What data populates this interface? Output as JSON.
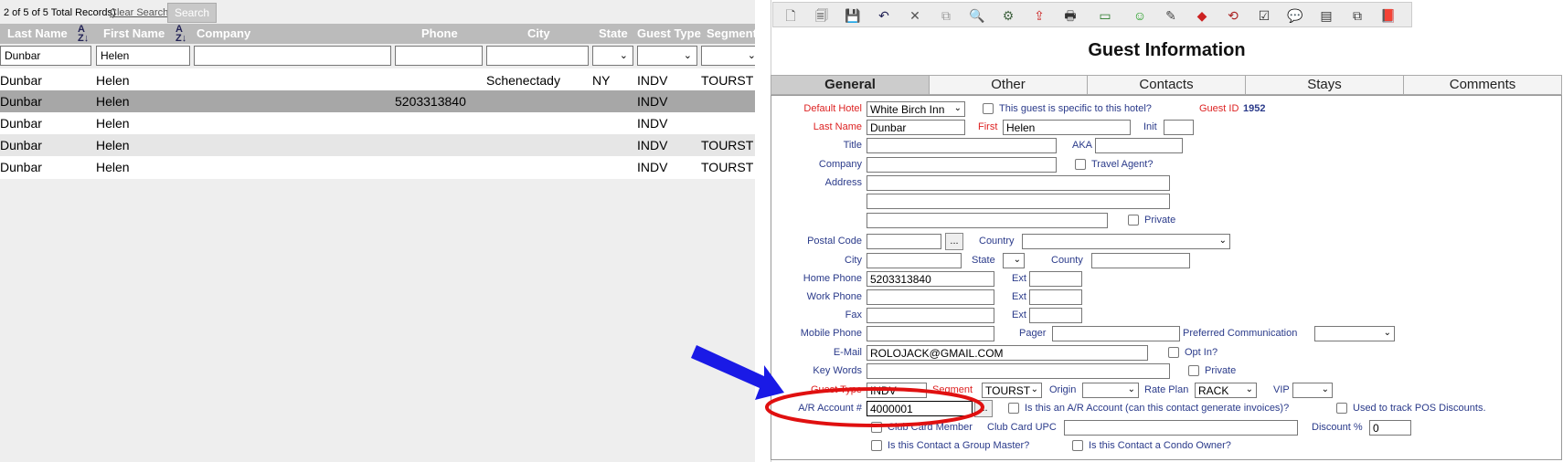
{
  "search": {
    "record_count": "2 of 5 of 5 Total Records)",
    "clear_label": "Clear Search",
    "search_label": "Search"
  },
  "grid": {
    "headers": [
      "Last Name",
      "First Name",
      "Company",
      "Phone",
      "City",
      "State",
      "Guest Type",
      "Segment"
    ],
    "filters": {
      "last_name": "Dunbar",
      "first_name": "Helen"
    },
    "rows": [
      {
        "last": "Dunbar",
        "first": "Helen",
        "phone": "",
        "city": "Schenectady",
        "state": "NY",
        "type": "INDV",
        "segment": "TOURST"
      },
      {
        "last": "Dunbar",
        "first": "Helen",
        "phone": "5203313840",
        "city": "",
        "state": "",
        "type": "INDV",
        "segment": ""
      },
      {
        "last": "Dunbar",
        "first": "Helen",
        "phone": "",
        "city": "",
        "state": "",
        "type": "INDV",
        "segment": ""
      },
      {
        "last": "Dunbar",
        "first": "Helen",
        "phone": "",
        "city": "",
        "state": "",
        "type": "INDV",
        "segment": "TOURST"
      },
      {
        "last": "Dunbar",
        "first": "Helen",
        "phone": "",
        "city": "",
        "state": "",
        "type": "INDV",
        "segment": "TOURST"
      }
    ]
  },
  "toolbar": {
    "icons": [
      "new-icon",
      "copy-icon",
      "save-icon",
      "undo-icon",
      "delete-icon",
      "merge-icon",
      "find-icon",
      "tools-icon",
      "export-icon",
      "print-icon",
      "money-icon",
      "smile-icon",
      "magic-icon",
      "tag-icon",
      "history-icon",
      "checklist-icon",
      "comment-icon",
      "document-icon",
      "copy-doc-icon",
      "book-icon"
    ]
  },
  "title": "Guest Information",
  "tabs": [
    "General",
    "Other",
    "Contacts",
    "Stays",
    "Comments"
  ],
  "form": {
    "default_hotel_label": "Default Hotel",
    "default_hotel": "White Birch Inn",
    "specific_label": "This guest is specific to this hotel?",
    "guest_id_label": "Guest ID",
    "guest_id": "1952",
    "last_name_label": "Last Name",
    "last_name": "Dunbar",
    "first_label": "First",
    "first_name": "Helen",
    "init_label": "Init",
    "title_label": "Title",
    "aka_label": "AKA",
    "company_label": "Company",
    "travel_agent_label": "Travel Agent?",
    "address_label": "Address",
    "private_label": "Private",
    "postal_label": "Postal Code",
    "ellipsis": "...",
    "country_label": "Country",
    "city_label": "City",
    "state_label": "State",
    "county_label": "County",
    "home_phone_label": "Home Phone",
    "home_phone": "5203313840",
    "ext_label": "Ext",
    "work_phone_label": "Work Phone",
    "fax_label": "Fax",
    "mobile_label": "Mobile Phone",
    "pager_label": "Pager",
    "pref_comm_label": "Preferred Communication",
    "email_label": "E-Mail",
    "email": "ROLOJACK@GMAIL.COM",
    "optin_label": "Opt In?",
    "keywords_label": "Key Words",
    "guest_type_label": "Guest Type",
    "guest_type": "INDV",
    "segment_label": "Segment",
    "segment": "TOURST",
    "origin_label": "Origin",
    "rate_plan_label": "Rate Plan",
    "rate_plan": "RACK",
    "vip_label": "VIP",
    "ar_label": "A/R Account #",
    "ar_value": "4000001",
    "ar_question": "Is this an A/R Account (can this contact generate invoices)?",
    "pos_label": "Used to track POS Discounts.",
    "club_member_label": "Club Card Member",
    "club_upc_label": "Club Card UPC",
    "discount_label": "Discount %",
    "discount": "0",
    "group_master_label": "Is this Contact a Group Master?",
    "condo_label": "Is this Contact a Condo Owner?"
  }
}
